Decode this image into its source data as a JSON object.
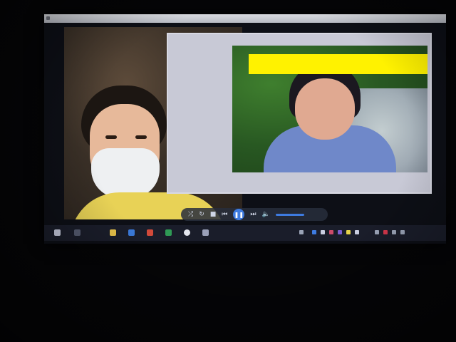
{
  "window": {
    "titlebar_visible": true
  },
  "media_controls": {
    "play_state": "paused",
    "icons": [
      "shuffle-icon",
      "repeat-icon",
      "stop-icon",
      "previous-icon",
      "play-pause-icon",
      "next-icon",
      "volume-icon"
    ]
  },
  "taskbar": {
    "icons": [
      "start-icon",
      "search-icon",
      "file-explorer-icon",
      "edge-icon",
      "powerpoint-icon",
      "excel-icon",
      "settings-icon",
      "photos-icon"
    ],
    "tray_icons": [
      "network-icon",
      "volume-icon",
      "battery-icon"
    ]
  },
  "colors": {
    "redaction": "#fff200",
    "accent": "#3e7be0",
    "taskbar": "#1a1d2a"
  }
}
